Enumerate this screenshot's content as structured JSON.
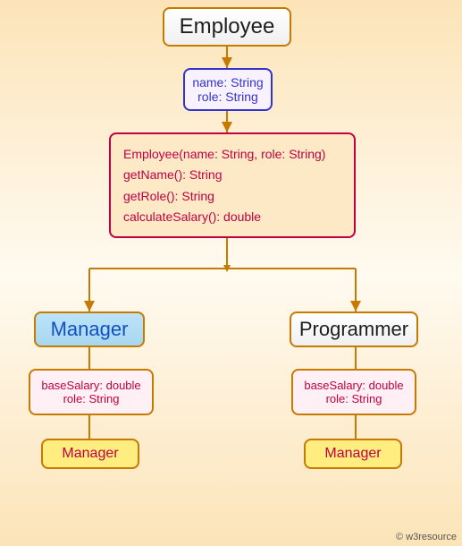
{
  "classes": {
    "employee": {
      "title": "Employee",
      "attrs": [
        "name: String",
        "role: String"
      ],
      "methods": [
        "Employee(name: String, role: String)",
        "getName(): String",
        "getRole(): String",
        "calculateSalary(): double"
      ]
    },
    "manager": {
      "title": "Manager",
      "attrs": [
        "baseSalary: double",
        "role: String"
      ],
      "label": "Manager"
    },
    "programmer": {
      "title": "Programmer",
      "attrs": [
        "baseSalary: double",
        "role: String"
      ],
      "label": "Manager"
    }
  },
  "watermark": "© w3resource"
}
